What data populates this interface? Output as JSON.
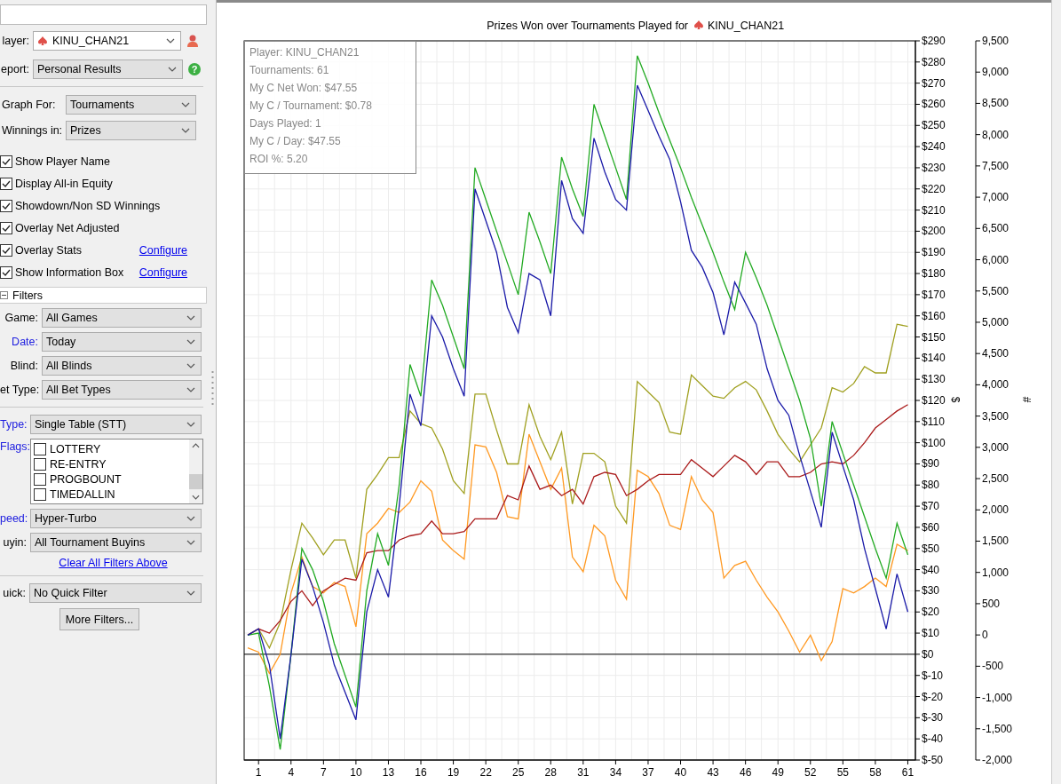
{
  "player": {
    "label": "layer:",
    "value": "KINU_CHAN21"
  },
  "report": {
    "label": "eport:",
    "value": "Personal Results",
    "help_glyph": "?"
  },
  "graph_options": [
    {
      "label": "Graph For:",
      "value": "Tournaments"
    },
    {
      "label": "Winnings in:",
      "value": "Prizes"
    }
  ],
  "options": [
    {
      "label": "Show Player Name",
      "checked": true
    },
    {
      "label": "Display All-in Equity",
      "checked": true
    },
    {
      "label": "Showdown/Non SD Winnings",
      "checked": true
    },
    {
      "label": "Overlay Net Adjusted",
      "checked": true
    },
    {
      "label": "Overlay Stats",
      "checked": true,
      "link": "Configure"
    },
    {
      "label": "Show Information Box",
      "checked": true,
      "link": "Configure"
    }
  ],
  "filters": {
    "title": "Filters",
    "expanded": true,
    "general": [
      {
        "label": "Game:",
        "value": "All Games",
        "active": false
      },
      {
        "label": "Date:",
        "value": "Today",
        "active": true
      },
      {
        "label": "Blind:",
        "value": "All Blinds",
        "active": false
      },
      {
        "label": "et Type:",
        "value": "All Bet Types",
        "active": false
      }
    ],
    "tournament": [
      {
        "kind": "select",
        "label": "Type:",
        "value": "Single Table (STT)",
        "active": true
      },
      {
        "kind": "flags",
        "label": "Flags:",
        "active": true,
        "items": [
          {
            "label": "LOTTERY",
            "checked": false
          },
          {
            "label": "RE-ENTRY",
            "checked": false
          },
          {
            "label": "PROGBOUNT",
            "checked": false
          },
          {
            "label": "TIMEDALLIN",
            "checked": false
          }
        ]
      },
      {
        "kind": "select",
        "label": "peed:",
        "value": "Hyper-Turbo",
        "active": true
      },
      {
        "kind": "select",
        "label": "uyin:",
        "value": "All Tournament Buyins",
        "active": false
      }
    ],
    "clear_link": "Clear All Filters Above"
  },
  "quick_filter": {
    "label": "uick:",
    "value": "No Quick Filter"
  },
  "more_filters_button": "More Filters...",
  "chart": {
    "player": "KINU_CHAN21",
    "info_box": [
      "Player: KINU_CHAN21",
      "Tournaments: 61",
      "My C Net Won: $47.55",
      "My C / Tournament: $0.78",
      "Days Played: 1",
      "My C / Day: $47.55",
      "ROI %: 5.20"
    ],
    "secondary_axis": {
      "label": "#",
      "ticks": [
        "9,500",
        "9,000",
        "8,500",
        "8,000",
        "7,500",
        "7,000",
        "6,500",
        "6,000",
        "5,500",
        "5,000",
        "4,500",
        "4,000",
        "3,500",
        "3,000",
        "2,500",
        "2,000",
        "1,500",
        "1,000",
        "500",
        "0",
        "-500",
        "-1,000",
        "-1,500",
        "-2,000"
      ]
    },
    "chart_data": {
      "type": "line",
      "grid": true,
      "title": "Prizes Won over Tournaments Played for",
      "ylabel": "$",
      "x": [
        0,
        1,
        2,
        3,
        4,
        5,
        6,
        7,
        8,
        9,
        10,
        11,
        12,
        13,
        14,
        15,
        16,
        17,
        18,
        19,
        20,
        21,
        22,
        23,
        24,
        25,
        26,
        27,
        28,
        29,
        30,
        31,
        32,
        33,
        34,
        35,
        36,
        37,
        38,
        39,
        40,
        41,
        42,
        43,
        44,
        45,
        46,
        47,
        48,
        49,
        50,
        51,
        52,
        53,
        54,
        55,
        56,
        57,
        58,
        59,
        60,
        61
      ],
      "xlim": [
        -0.33,
        61.7
      ],
      "ylim": [
        -50,
        290
      ],
      "xticks": [
        1,
        4,
        7,
        10,
        13,
        16,
        19,
        22,
        25,
        28,
        31,
        34,
        37,
        40,
        43,
        46,
        49,
        52,
        55,
        58,
        61
      ],
      "yticks": [
        {
          "value": -50,
          "label": "$-50"
        },
        {
          "value": -40,
          "label": "$-40"
        },
        {
          "value": -30,
          "label": "$-30"
        },
        {
          "value": -20,
          "label": "$-20"
        },
        {
          "value": -10,
          "label": "$-10"
        },
        {
          "value": 0,
          "label": "$0"
        },
        {
          "value": 10,
          "label": "$10"
        },
        {
          "value": 20,
          "label": "$20"
        },
        {
          "value": 30,
          "label": "$30"
        },
        {
          "value": 40,
          "label": "$40"
        },
        {
          "value": 50,
          "label": "$50"
        },
        {
          "value": 60,
          "label": "$60"
        },
        {
          "value": 70,
          "label": "$70"
        },
        {
          "value": 80,
          "label": "$80"
        },
        {
          "value": 90,
          "label": "$90"
        },
        {
          "value": 100,
          "label": "$100"
        },
        {
          "value": 110,
          "label": "$110"
        },
        {
          "value": 120,
          "label": "$120"
        },
        {
          "value": 130,
          "label": "$130"
        },
        {
          "value": 140,
          "label": "$140"
        },
        {
          "value": 150,
          "label": "$150"
        },
        {
          "value": 160,
          "label": "$160"
        },
        {
          "value": 170,
          "label": "$170"
        },
        {
          "value": 180,
          "label": "$180"
        },
        {
          "value": 190,
          "label": "$190"
        },
        {
          "value": 200,
          "label": "$200"
        },
        {
          "value": 210,
          "label": "$210"
        },
        {
          "value": 220,
          "label": "$220"
        },
        {
          "value": 230,
          "label": "$230"
        },
        {
          "value": 240,
          "label": "$240"
        },
        {
          "value": 250,
          "label": "$250"
        },
        {
          "value": 260,
          "label": "$260"
        },
        {
          "value": 270,
          "label": "$270"
        },
        {
          "value": 280,
          "label": "$280"
        },
        {
          "value": 290,
          "label": "$290"
        }
      ],
      "series": [
        {
          "color": "#a0a020",
          "values": [
            9,
            12,
            3,
            15,
            40,
            62,
            55,
            47,
            54,
            54,
            36,
            78,
            85,
            93,
            93,
            115,
            109,
            107,
            97,
            82,
            76,
            123,
            123,
            106,
            90,
            90,
            118,
            103,
            92,
            105,
            71,
            95,
            95,
            91,
            70,
            62,
            129,
            124,
            119,
            105,
            104,
            132,
            127,
            122,
            121,
            126,
            129,
            125,
            115,
            104,
            97,
            91,
            99,
            107,
            126,
            124,
            128,
            136,
            133,
            133,
            156,
            155
          ]
        },
        {
          "color": "#ff9922",
          "values": [
            3,
            1,
            -9,
            0,
            29,
            46,
            32,
            29,
            34,
            32,
            13,
            57,
            62,
            69,
            67,
            72,
            82,
            77,
            54,
            49,
            45,
            99,
            98,
            86,
            65,
            64,
            104,
            91,
            78,
            88,
            46,
            39,
            61,
            56,
            35,
            26,
            87,
            84,
            76,
            61,
            59,
            84,
            73,
            67,
            36,
            42,
            44,
            35,
            27,
            20,
            11,
            1,
            9,
            -3,
            6,
            31,
            29,
            32,
            36,
            32,
            52,
            49
          ]
        },
        {
          "color": "#aa1a1a",
          "values": [
            9,
            12,
            10,
            16,
            25,
            30,
            23,
            30,
            33,
            36,
            35,
            48,
            49,
            49,
            54,
            56,
            57,
            63,
            57,
            57,
            58,
            64,
            64,
            64,
            75,
            73,
            89,
            78,
            80,
            75,
            78,
            71,
            84,
            86,
            85,
            75,
            78,
            82,
            85,
            85,
            85,
            92,
            88,
            84,
            89,
            94,
            91,
            85,
            91,
            91,
            84,
            84,
            86,
            90,
            91,
            90,
            94,
            100,
            107,
            111,
            115,
            118
          ]
        },
        {
          "color": "#22aa22",
          "values": [
            9,
            10,
            -15,
            -45,
            0,
            50,
            40,
            25,
            5,
            -10,
            -25,
            30,
            57,
            42,
            80,
            137,
            122,
            177,
            165,
            150,
            135,
            230,
            215,
            200,
            185,
            170,
            209,
            195,
            180,
            235,
            220,
            207,
            260,
            245,
            230,
            215,
            283,
            270,
            256,
            243,
            230,
            216,
            203,
            190,
            176,
            163,
            190,
            178,
            165,
            150,
            135,
            120,
            102,
            70,
            110,
            95,
            80,
            65,
            50,
            36,
            62,
            47
          ]
        },
        {
          "color": "#1a1aa8",
          "values": [
            9,
            12,
            -5,
            -40,
            0,
            45,
            32,
            15,
            -5,
            -18,
            -31,
            20,
            40,
            27,
            70,
            123,
            108,
            160,
            150,
            135,
            122,
            220,
            205,
            190,
            164,
            152,
            180,
            177,
            160,
            224,
            206,
            199,
            244,
            228,
            215,
            210,
            269,
            257,
            245,
            234,
            214,
            191,
            183,
            171,
            151,
            176,
            166,
            156,
            135,
            120,
            113,
            94,
            77,
            60,
            105,
            89,
            73,
            50,
            31,
            12,
            38,
            20
          ]
        }
      ]
    }
  }
}
